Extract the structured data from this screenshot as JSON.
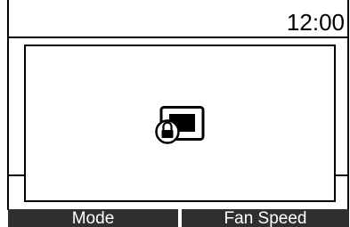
{
  "status_bar": {
    "time": "12:00"
  },
  "dialog": {
    "icon": "screen-lock-icon"
  },
  "softkeys": [
    {
      "label": "Mode"
    },
    {
      "label": "Fan Speed"
    }
  ],
  "colors": {
    "background": "#ffffff",
    "foreground": "#000000",
    "softkey_background": "#2f2f2f",
    "softkey_text": "#ffffff"
  }
}
